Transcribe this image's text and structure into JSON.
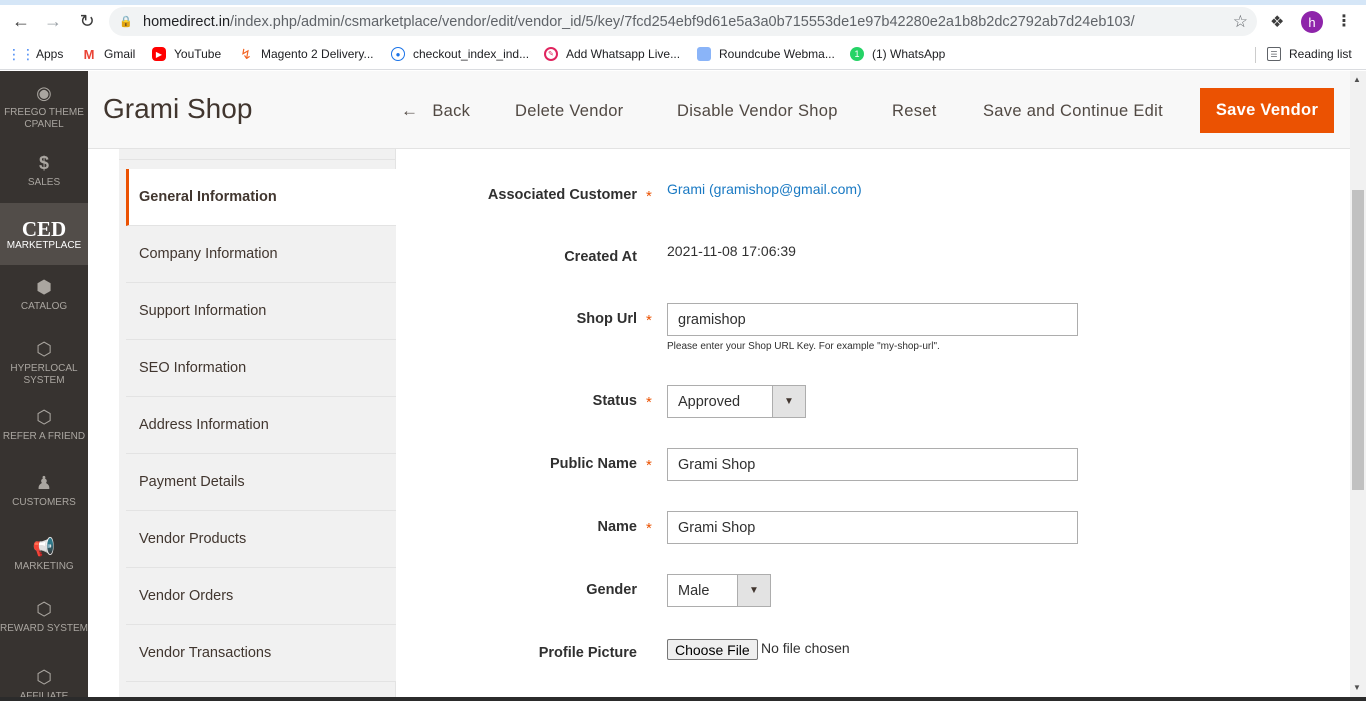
{
  "browser": {
    "url_host": "homedirect.in",
    "url_path": "/index.php/admin/csmarketplace/vendor/edit/vendor_id/5/key/7fcd254ebf9d61e5a3a0b715553de1e97b42280e2a1b8b2dc2792ab7d24eb103/",
    "profile_initial": "h",
    "bookmarks": [
      {
        "label": "Apps",
        "icon": "apps-grid-icon"
      },
      {
        "label": "Gmail",
        "icon": "gmail-icon"
      },
      {
        "label": "YouTube",
        "icon": "youtube-icon"
      },
      {
        "label": "Magento 2 Delivery...",
        "icon": "magento-icon"
      },
      {
        "label": "checkout_index_ind...",
        "icon": "globe-icon"
      },
      {
        "label": "Add Whatsapp Live...",
        "icon": "whatsapp-live-icon"
      },
      {
        "label": "Roundcube Webma...",
        "icon": "roundcube-icon"
      },
      {
        "label": "(1) WhatsApp",
        "icon": "whatsapp-icon"
      }
    ],
    "reading_list": "Reading list"
  },
  "admin_nav": [
    {
      "label": "FREEGO THEME CPANEL",
      "icon": "target-icon"
    },
    {
      "label": "SALES",
      "icon": "dollar-icon"
    },
    {
      "label": "MARKETPLACE",
      "logo": "CED",
      "icon": "ced-logo"
    },
    {
      "label": "CATALOG",
      "icon": "box-icon"
    },
    {
      "label": "HYPERLOCAL SYSTEM",
      "icon": "hexagon-icon"
    },
    {
      "label": "REFER A FRIEND",
      "icon": "hexagon-icon"
    },
    {
      "label": "CUSTOMERS",
      "icon": "person-icon"
    },
    {
      "label": "MARKETING",
      "icon": "megaphone-icon"
    },
    {
      "label": "REWARD SYSTEM",
      "icon": "hexagon-icon"
    },
    {
      "label": "AFFILIATE",
      "icon": "hexagon-icon"
    }
  ],
  "header": {
    "title": "Grami Shop",
    "back": "Back",
    "delete": "Delete Vendor",
    "disable": "Disable Vendor Shop",
    "reset": "Reset",
    "save_continue": "Save and Continue Edit",
    "save": "Save Vendor"
  },
  "tabs": [
    "General Information",
    "Company Information",
    "Support Information",
    "SEO Information",
    "Address Information",
    "Payment Details",
    "Vendor Products",
    "Vendor Orders",
    "Vendor Transactions"
  ],
  "form": {
    "associated_customer": {
      "label": "Associated Customer",
      "value": "Grami (gramishop@gmail.com)"
    },
    "created_at": {
      "label": "Created At",
      "value": "2021-11-08 17:06:39"
    },
    "shop_url": {
      "label": "Shop Url",
      "value": "gramishop",
      "note": "Please enter your Shop URL Key. For example \"my-shop-url\"."
    },
    "status": {
      "label": "Status",
      "value": "Approved"
    },
    "public_name": {
      "label": "Public Name",
      "value": "Grami Shop"
    },
    "name": {
      "label": "Name",
      "value": "Grami Shop"
    },
    "gender": {
      "label": "Gender",
      "value": "Male"
    },
    "profile_picture": {
      "label": "Profile Picture",
      "button": "Choose File",
      "status": "No file chosen"
    },
    "required_mark": "*"
  },
  "colors": {
    "accent": "#eb5202",
    "nav_bg": "#373330",
    "link": "#1979c3"
  }
}
